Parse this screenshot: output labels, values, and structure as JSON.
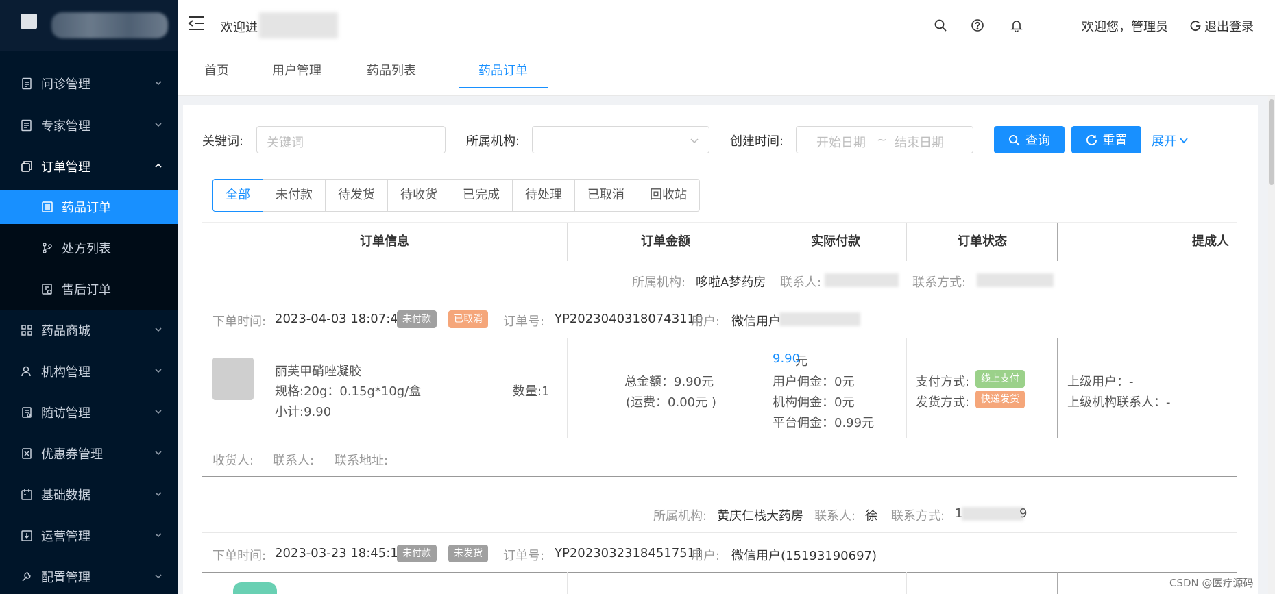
{
  "header": {
    "welcome_prefix": "欢迎进",
    "greeting": "欢迎您，管理员",
    "logout_label": "退出登录"
  },
  "sidebar": {
    "items": [
      {
        "label": "问诊管理"
      },
      {
        "label": "专家管理"
      },
      {
        "label": "订单管理"
      },
      {
        "label": "药品商城"
      },
      {
        "label": "机构管理"
      },
      {
        "label": "随访管理"
      },
      {
        "label": "优惠券管理"
      },
      {
        "label": "基础数据"
      },
      {
        "label": "运营管理"
      },
      {
        "label": "配置管理"
      }
    ],
    "sub_items": [
      {
        "label": "药品订单"
      },
      {
        "label": "处方列表"
      },
      {
        "label": "售后订单"
      }
    ]
  },
  "tabs": [
    "首页",
    "用户管理",
    "药品列表",
    "药品订单"
  ],
  "filters": {
    "keyword_label": "关键词:",
    "keyword_placeholder": "关键词",
    "org_label": "所属机构:",
    "org_value": "",
    "created_label": "创建时间:",
    "start_placeholder": "开始日期",
    "range_sep": "~",
    "end_placeholder": "结束日期",
    "search_label": "查询",
    "reset_label": "重置",
    "expand_label": "展开"
  },
  "status_tabs": [
    "全部",
    "未付款",
    "待发货",
    "待收货",
    "已完成",
    "待处理",
    "已取消",
    "回收站"
  ],
  "table": {
    "columns": [
      "订单信息",
      "订单金额",
      "实际付款",
      "订单状态",
      "提成人"
    ]
  },
  "orders": [
    {
      "org_label": "所属机构:",
      "org_name": "哆啦A梦药房",
      "contact_label": "联系人:",
      "contact_name": "",
      "phone_label": "联系方式:",
      "phone": "",
      "time_label": "下单时间:",
      "time": "2023-04-03 18:07:44",
      "badge1": "未付款",
      "badge2": "已取消",
      "order_no_label": "订单号:",
      "order_no": "YP20230403180743110",
      "user_label": "用户:",
      "user": "微信用户",
      "product_name": "丽芙甲硝唑凝胶",
      "spec": "规格:20g：0.15g*10g/盒",
      "subtotal": "小计:9.90",
      "qty": "数量:1",
      "total": "总金额：9.90元",
      "shipping": "(运费：0.00元 )",
      "paid_amount": "9.90",
      "paid_unit": "元",
      "user_commission": "用户佣金：0元",
      "org_commission": "机构佣金：0元",
      "platform_commission": "平台佣金：0.99元",
      "pay_method_label": "支付方式:",
      "pay_method": "线上支付",
      "ship_method_label": "发货方式:",
      "ship_method": "快递发货",
      "upper_user": "上级用户：-",
      "upper_org_contact": "上级机构联系人：-",
      "receiver_label": "收货人:",
      "receiver_contact_label": "联系人:",
      "receiver_address_label": "联系地址:"
    },
    {
      "org_label": "所属机构:",
      "org_name": "黄庆仁栈大药房",
      "contact_label": "联系人:",
      "contact_name": "徐",
      "phone_label": "联系方式:",
      "phone_prefix": "1",
      "phone_suffix": "9",
      "time_label": "下单时间:",
      "time": "2023-03-23 18:45:17",
      "badge1": "未付款",
      "badge2": "未发货",
      "order_no_label": "订单号:",
      "order_no": "YP20230323184517511",
      "user_label": "用户:",
      "user": "微信用户(15193190697)"
    }
  ],
  "watermark": "CSDN @医疗源码"
}
